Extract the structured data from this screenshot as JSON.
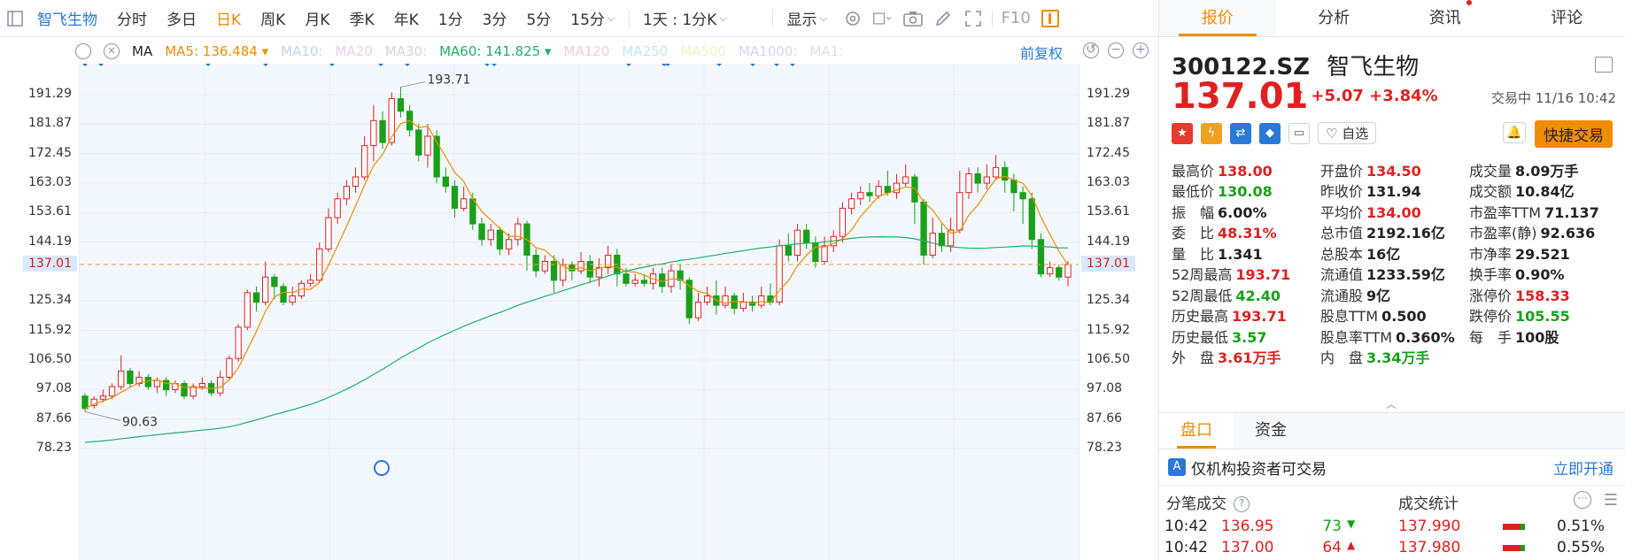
{
  "toolbar": {
    "stock_name": "智飞生物",
    "periods": [
      "分时",
      "多日",
      "日K",
      "周K",
      "月K",
      "季K",
      "年K",
      "1分",
      "3分",
      "5分"
    ],
    "active_period": "日K",
    "period_select": "15分",
    "multi_day": "1天 : 1分K",
    "display": "显示",
    "f10": "F10"
  },
  "ma_bar": {
    "ma_label": "MA",
    "items": [
      {
        "label": "MA5:",
        "value": "136.484",
        "color": "#f08c00",
        "dim": false
      },
      {
        "label": "MA10:",
        "value": "",
        "color": "#7fb9f0",
        "dim": true
      },
      {
        "label": "MA20",
        "value": "",
        "color": "#e6a0d8",
        "dim": true
      },
      {
        "label": "MA30:",
        "value": "",
        "color": "#9fb3d0",
        "dim": true
      },
      {
        "label": "MA60:",
        "value": "141.825",
        "color": "#1fb06a",
        "dim": false
      },
      {
        "label": "MA120",
        "value": "",
        "color": "#f0a0b0",
        "dim": true
      },
      {
        "label": "MA250",
        "value": "",
        "color": "#80d8e8",
        "dim": true
      },
      {
        "label": "MA500",
        "value": "",
        "color": "#f0e090",
        "dim": true
      },
      {
        "label": "MA1000:",
        "value": "",
        "color": "#c0a8e8",
        "dim": true
      },
      {
        "label": "MA1:",
        "value": "",
        "color": "#c0c8d4",
        "dim": true
      }
    ],
    "restore": "前复权"
  },
  "chart_data": {
    "type": "candlestick",
    "y_ticks": [
      "191.29",
      "181.87",
      "172.45",
      "163.03",
      "153.61",
      "144.19",
      "125.34",
      "115.92",
      "106.50",
      "97.08",
      "87.66",
      "78.23"
    ],
    "current_price_tag": "137.01",
    "ylim": [
      78.23,
      191.29
    ],
    "max_label": "193.71",
    "min_label": "90.63",
    "candles": [
      [
        95,
        91,
        96,
        90
      ],
      [
        92,
        94,
        95,
        91
      ],
      [
        94,
        95,
        97,
        93
      ],
      [
        95,
        98,
        99,
        94
      ],
      [
        98,
        103,
        108,
        97
      ],
      [
        103,
        99,
        104,
        98
      ],
      [
        99,
        101,
        103,
        98
      ],
      [
        101,
        98,
        102,
        97
      ],
      [
        98,
        100,
        101,
        96
      ],
      [
        100,
        97,
        101,
        95
      ],
      [
        97,
        99,
        100,
        96
      ],
      [
        99,
        95,
        100,
        94
      ],
      [
        95,
        98,
        99,
        94
      ],
      [
        98,
        99,
        101,
        97
      ],
      [
        99,
        96,
        100,
        95
      ],
      [
        96,
        101,
        103,
        95
      ],
      [
        101,
        107,
        108,
        100
      ],
      [
        107,
        117,
        118,
        106
      ],
      [
        117,
        128,
        129,
        116
      ],
      [
        128,
        125,
        130,
        122
      ],
      [
        125,
        133,
        138,
        124
      ],
      [
        133,
        130,
        134,
        126
      ],
      [
        130,
        125,
        131,
        124
      ],
      [
        125,
        127,
        130,
        124
      ],
      [
        127,
        131,
        132,
        126
      ],
      [
        131,
        132,
        134,
        130
      ],
      [
        132,
        142,
        144,
        131
      ],
      [
        142,
        152,
        155,
        141
      ],
      [
        152,
        158,
        160,
        150
      ],
      [
        158,
        162,
        164,
        156
      ],
      [
        162,
        165,
        168,
        160
      ],
      [
        165,
        175,
        178,
        164
      ],
      [
        175,
        183,
        188,
        170
      ],
      [
        183,
        176,
        186,
        174
      ],
      [
        176,
        190,
        192,
        175
      ],
      [
        190,
        186,
        193.71,
        184
      ],
      [
        186,
        180,
        188,
        178
      ],
      [
        180,
        172,
        182,
        170
      ],
      [
        172,
        178,
        182,
        168
      ],
      [
        178,
        165,
        180,
        163
      ],
      [
        165,
        162,
        168,
        160
      ],
      [
        162,
        155,
        164,
        152
      ],
      [
        155,
        158,
        162,
        154
      ],
      [
        158,
        150,
        160,
        148
      ],
      [
        150,
        145,
        152,
        143
      ],
      [
        145,
        148,
        150,
        143
      ],
      [
        148,
        142,
        149,
        140
      ],
      [
        142,
        145,
        147,
        140
      ],
      [
        145,
        150,
        152,
        143
      ],
      [
        150,
        140,
        151,
        135
      ],
      [
        140,
        135,
        142,
        133
      ],
      [
        135,
        138,
        140,
        134
      ],
      [
        138,
        132,
        140,
        128
      ],
      [
        132,
        137,
        139,
        130
      ],
      [
        137,
        135,
        138,
        132
      ],
      [
        135,
        138,
        141,
        134
      ],
      [
        138,
        133,
        140,
        131
      ],
      [
        133,
        136,
        139,
        130
      ],
      [
        136,
        140,
        143,
        134
      ],
      [
        140,
        134,
        142,
        130
      ],
      [
        134,
        131,
        136,
        130
      ],
      [
        131,
        132,
        134,
        130
      ],
      [
        132,
        131,
        134,
        130
      ],
      [
        131,
        134,
        136,
        129
      ],
      [
        134,
        130,
        136,
        128
      ],
      [
        130,
        135,
        137,
        128
      ],
      [
        135,
        132,
        137,
        129
      ],
      [
        132,
        120,
        133,
        118
      ],
      [
        120,
        125,
        128,
        119
      ],
      [
        125,
        127,
        130,
        124
      ],
      [
        127,
        124,
        132,
        121
      ],
      [
        124,
        127,
        130,
        123
      ],
      [
        127,
        123,
        128,
        121
      ],
      [
        123,
        125,
        128,
        122
      ],
      [
        125,
        124,
        127,
        122
      ],
      [
        124,
        127,
        130,
        123
      ],
      [
        127,
        125,
        131,
        124
      ],
      [
        125,
        143,
        145,
        124
      ],
      [
        143,
        140,
        147,
        138
      ],
      [
        140,
        148,
        150,
        138
      ],
      [
        148,
        144,
        150,
        142
      ],
      [
        144,
        138,
        146,
        136
      ],
      [
        138,
        143,
        146,
        137
      ],
      [
        143,
        146,
        148,
        141
      ],
      [
        146,
        155,
        157,
        144
      ],
      [
        155,
        158,
        160,
        153
      ],
      [
        158,
        160,
        162,
        156
      ],
      [
        160,
        159,
        163,
        157
      ],
      [
        159,
        162,
        164,
        158
      ],
      [
        162,
        160,
        167,
        159
      ],
      [
        160,
        163,
        166,
        158
      ],
      [
        163,
        165,
        169,
        162
      ],
      [
        165,
        157,
        166,
        150
      ],
      [
        157,
        140,
        158,
        137
      ],
      [
        140,
        147,
        152,
        139
      ],
      [
        147,
        143,
        150,
        141
      ],
      [
        143,
        148,
        152,
        141
      ],
      [
        148,
        160,
        167,
        147
      ],
      [
        160,
        166,
        168,
        158
      ],
      [
        166,
        163,
        168,
        160
      ],
      [
        163,
        165,
        169,
        161
      ],
      [
        165,
        168,
        172,
        164
      ],
      [
        168,
        164,
        170,
        160
      ],
      [
        164,
        160,
        166,
        154
      ],
      [
        160,
        158,
        162,
        150
      ],
      [
        158,
        145,
        160,
        142
      ],
      [
        145,
        134,
        147,
        133
      ],
      [
        134,
        136,
        138,
        133
      ],
      [
        136,
        133,
        137,
        132
      ],
      [
        133,
        137.01,
        138,
        130
      ]
    ]
  },
  "right_panel": {
    "tabs": [
      "报价",
      "分析",
      "资讯",
      "评论"
    ],
    "active_tab": "报价",
    "code": "300122.SZ",
    "name": "智飞生物",
    "price": "137.01",
    "change": "+5.07",
    "change_pct": "+3.84%",
    "trade_time": "交易中 11/16 10:42",
    "zixuan": "自选",
    "quick_trade": "快捷交易",
    "quote_rows": [
      [
        {
          "l": "最高价",
          "v": "138.00",
          "c": "up"
        },
        {
          "l": "开盘价",
          "v": "134.50",
          "c": "up"
        },
        {
          "l": "成交量",
          "v": "8.09万手",
          "c": "nu"
        }
      ],
      [
        {
          "l": "最低价",
          "v": "130.08",
          "c": "dn"
        },
        {
          "l": "昨收价",
          "v": "131.94",
          "c": "nu"
        },
        {
          "l": "成交额",
          "v": "10.84亿",
          "c": "nu"
        }
      ],
      [
        {
          "l": "振　幅",
          "v": "6.00%",
          "c": "nu"
        },
        {
          "l": "平均价",
          "v": "134.00",
          "c": "up"
        },
        {
          "l": "市盈率TTM",
          "v": "71.137",
          "c": "nu"
        }
      ],
      [
        {
          "l": "委　比",
          "v": "48.31%",
          "c": "up"
        },
        {
          "l": "总市值",
          "v": "2192.16亿",
          "c": "nu"
        },
        {
          "l": "市盈率(静)",
          "v": "92.636",
          "c": "nu"
        }
      ],
      [
        {
          "l": "量　比",
          "v": "1.341",
          "c": "nu"
        },
        {
          "l": "总股本",
          "v": "16亿",
          "c": "nu"
        },
        {
          "l": "市净率",
          "v": "29.521",
          "c": "nu"
        }
      ],
      [
        {
          "l": "52周最高",
          "v": "193.71",
          "c": "up"
        },
        {
          "l": "流通值",
          "v": "1233.59亿",
          "c": "nu"
        },
        {
          "l": "换手率",
          "v": "0.90%",
          "c": "nu"
        }
      ],
      [
        {
          "l": "52周最低",
          "v": "42.40",
          "c": "dn"
        },
        {
          "l": "流通股",
          "v": "9亿",
          "c": "nu"
        },
        {
          "l": "涨停价",
          "v": "158.33",
          "c": "up"
        }
      ],
      [
        {
          "l": "历史最高",
          "v": "193.71",
          "c": "up"
        },
        {
          "l": "股息TTM",
          "v": "0.500",
          "c": "nu"
        },
        {
          "l": "跌停价",
          "v": "105.55",
          "c": "dn"
        }
      ],
      [
        {
          "l": "历史最低",
          "v": "3.57",
          "c": "dn"
        },
        {
          "l": "股息率TTM",
          "v": "0.360%",
          "c": "nu"
        },
        {
          "l": "每　手",
          "v": "100股",
          "c": "nu"
        }
      ],
      [
        {
          "l": "外　盘",
          "v": "3.61万手",
          "c": "up"
        },
        {
          "l": "内　盘",
          "v": "3.34万手",
          "c": "dn"
        },
        {
          "l": "",
          "v": "",
          "c": "nu"
        }
      ]
    ],
    "pankou_tabs": [
      "盘口",
      "资金"
    ],
    "inst_text": "仅机构投资者可交易",
    "inst_link": "立即开通",
    "ticks_title": "分笔成交",
    "stats_title": "成交统计",
    "ticks": [
      {
        "time": "10:42",
        "price": "136.95",
        "vol": "73",
        "dir": "down"
      },
      {
        "time": "10:42",
        "price": "137.00",
        "vol": "64",
        "dir": "up"
      }
    ],
    "stats": [
      {
        "price": "137.990",
        "pct": "0.51%"
      },
      {
        "price": "137.980",
        "pct": "0.55%"
      }
    ]
  }
}
